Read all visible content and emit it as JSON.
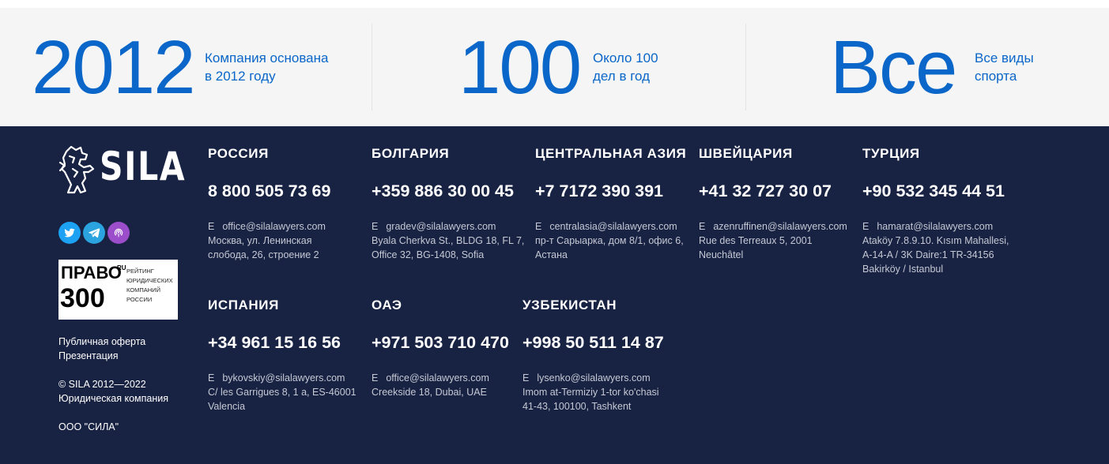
{
  "stats": [
    {
      "number": "2012",
      "text_line1": "Компания основана",
      "text_line2": "в 2012 году"
    },
    {
      "number": "100",
      "text_line1": "Около 100",
      "text_line2": "дел в год"
    },
    {
      "number": "Все",
      "text_line1": "Все виды",
      "text_line2": "спорта"
    }
  ],
  "brand": {
    "logo_text": "SILA",
    "rating_big": "ПРАВО",
    "rating_num": "300",
    "rating_ru": "RU",
    "rating_caption": "Рейтинг юридических компаний России"
  },
  "footer_links": {
    "offer": "Публичная оферта",
    "presentation": "Презентация",
    "copyright": "© SILA 2012—2022",
    "company_type": "Юридическая компания",
    "legal_name": "ООО \"СИЛА\""
  },
  "email_prefix": "E",
  "offices": [
    {
      "country": "РОССИЯ",
      "phone": "8 800 505 73 69",
      "email": "office@silalawyers.com",
      "address": "Москва, ул. Ленинская\nслобода, 26, строение 2"
    },
    {
      "country": "БОЛГАРИЯ",
      "phone": "+359 886 30 00 45",
      "email": "gradev@silalawyers.com",
      "address": "Byala Cherkva St., BLDG 18, FL 7,\nOffice 32, BG-1408, Sofia"
    },
    {
      "country": "ЦЕНТРАЛЬНАЯ АЗИЯ",
      "phone": "+7 7172 390 391",
      "email": "centralasia@silalawyers.com",
      "address": "пр-т Сарыарка, дом 8/1, офис 6,\nАстана"
    },
    {
      "country": "ШВЕЙЦАРИЯ",
      "phone": "+41 32 727 30 07",
      "email": "azenruffinen@silalawyers.com",
      "address": "Rue des Terreaux 5, 2001\nNeuchâtel"
    },
    {
      "country": "ТУРЦИЯ",
      "phone": "+90 532 345 44 51",
      "email": "hamarat@silalawyers.com",
      "address": "Ataköy 7.8.9.10. Kısım Mahallesi,\nA-14-A / 3K Daire:1 TR-34156\nBakirköy / Istanbul"
    },
    {
      "country": "ИСПАНИЯ",
      "phone": "+34 961 15 16 56",
      "email": "bykovskiy@silalawyers.com",
      "address": "C/ les Garrigues 8, 1 a, ES-46001\nValencia"
    },
    {
      "country": "ОАЭ",
      "phone": "+971 503 710 470",
      "email": "office@silalawyers.com",
      "address": "Creekside 18, Dubai, UAE"
    },
    {
      "country": "УЗБЕКИСТАН",
      "phone": "+998 50 511 14 87",
      "email": "lysenko@silalawyers.com",
      "address": "Imom at-Termiziy 1-tor ko'chasi\n41-43, 100100, Tashkent"
    }
  ],
  "icons": [
    "twitter-icon",
    "telegram-icon",
    "podcast-icon",
    "lion-logo-icon"
  ],
  "colors": {
    "accent": "#0a66c8",
    "footer_bg": "#182243",
    "stats_bg": "#f5f5f5",
    "twitter": "#1da1f2",
    "telegram": "#2aa3df",
    "podcast": "#9b4dca"
  }
}
